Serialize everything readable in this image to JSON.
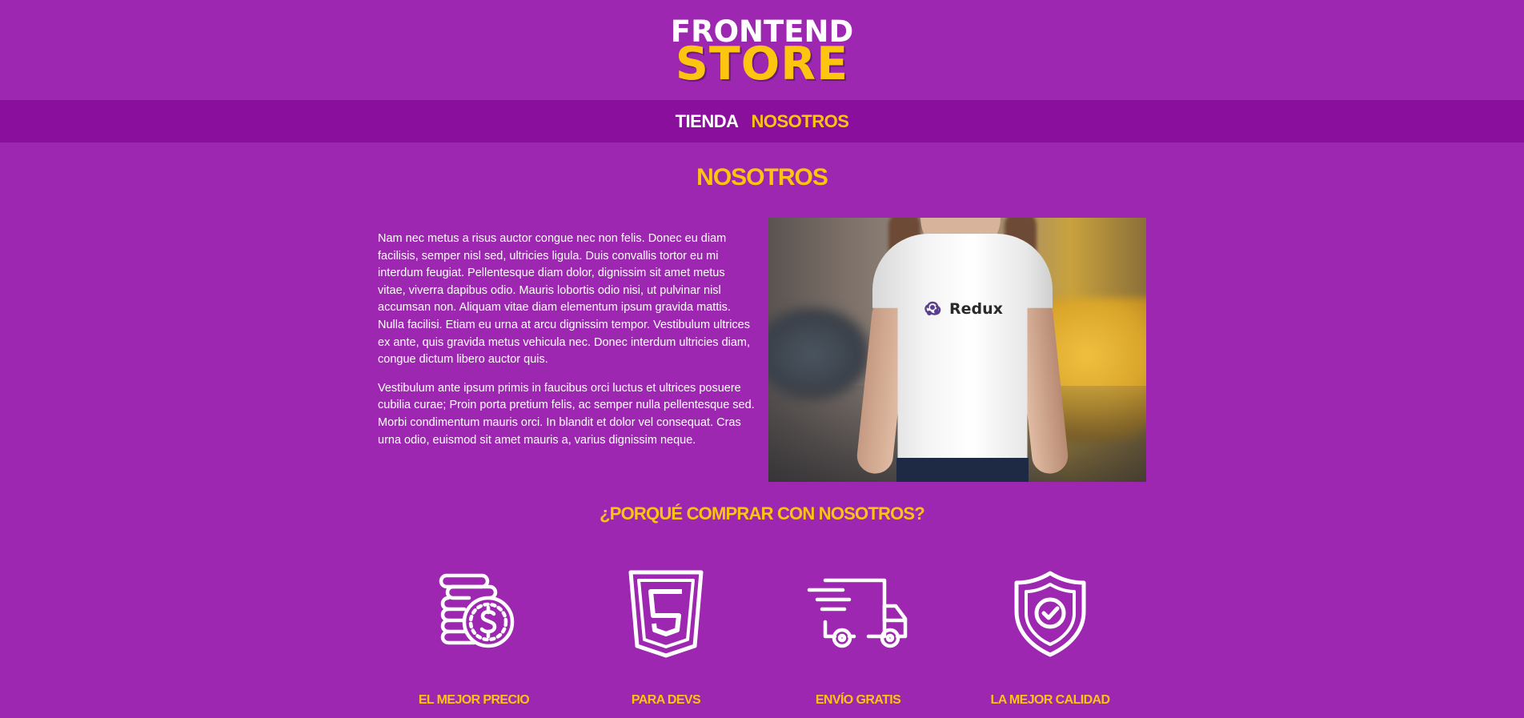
{
  "header": {
    "logo_top": "FRONTEND",
    "logo_bottom": "STORE"
  },
  "nav": {
    "items": [
      {
        "label": "TIENDA",
        "active": false
      },
      {
        "label": "NOSOTROS",
        "active": true
      }
    ]
  },
  "about": {
    "title": "NOSOTROS",
    "paragraphs": [
      "Nam nec metus a risus auctor congue nec non felis. Donec eu diam facilisis, semper nisl sed, ultricies ligula. Duis convallis tortor eu mi interdum feugiat. Pellentesque diam dolor, dignissim sit amet metus vitae, viverra dapibus odio. Mauris lobortis odio nisi, ut pulvinar nisl accumsan non. Aliquam vitae diam elementum ipsum gravida mattis. Nulla facilisi. Etiam eu urna at arcu dignissim tempor. Vestibulum ultrices ex ante, quis gravida metus vehicula nec. Donec interdum ultricies diam, congue dictum libero auctor quis.",
      "Vestibulum ante ipsum primis in faucibus orci luctus et ultrices posuere cubilia curae; Proin porta pretium felis, ac semper nulla pellentesque sed. Morbi condimentum mauris orci. In blandit et dolor vel consequat. Cras urna odio, euismod sit amet mauris a, varius dignissim neque."
    ],
    "image_shirt_text": "Redux"
  },
  "why": {
    "title": "¿PORQUÉ COMPRAR CON NOSOTROS?",
    "features": [
      {
        "label": "EL MEJOR PRECIO",
        "icon": "coins-dollar-icon"
      },
      {
        "label": "PARA DEVS",
        "icon": "html5-icon"
      },
      {
        "label": "ENVÍO GRATIS",
        "icon": "delivery-truck-icon"
      },
      {
        "label": "LA MEJOR CALIDAD",
        "icon": "shield-check-icon"
      }
    ]
  },
  "colors": {
    "background": "#9d27b0",
    "nav_background": "#8a0f9c",
    "accent": "#fdc50f",
    "text": "#ffffff"
  }
}
